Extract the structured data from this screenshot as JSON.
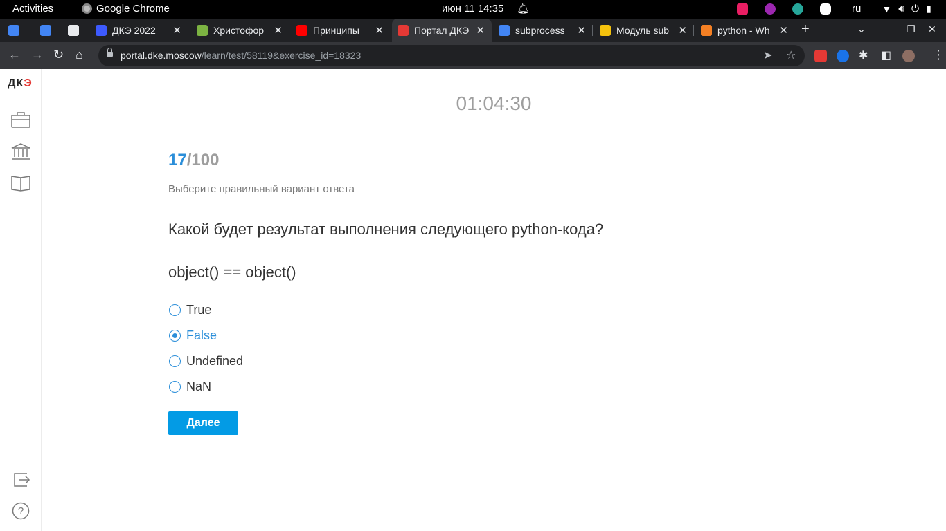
{
  "system": {
    "activities": "Activities",
    "app_name": "Google Chrome",
    "clock": "июн 11  14:35",
    "language": "ru"
  },
  "tabs": [
    {
      "title": "",
      "favicon_color": "#4285f4"
    },
    {
      "title": "",
      "favicon_color": "#4285f4"
    },
    {
      "title": "",
      "favicon_color": "#e8eaed"
    },
    {
      "title": "ДКЭ 2022",
      "favicon_color": "#3d5afe"
    },
    {
      "title": "Христофор",
      "favicon_color": "#7cb342"
    },
    {
      "title": "Принципы",
      "favicon_color": "#ff0000"
    },
    {
      "title": "Портал ДКЭ",
      "favicon_color": "#e53935"
    },
    {
      "title": "subprocess",
      "favicon_color": "#4285f4"
    },
    {
      "title": "Модуль sub",
      "favicon_color": "#f4c20d"
    },
    {
      "title": "python - Wh",
      "favicon_color": "#f48024"
    }
  ],
  "browser": {
    "url_host": "portal.dke.moscow",
    "url_path": "/learn/test/58119&exercise_id=18323"
  },
  "sidebar": {
    "logo_main": "ДК",
    "logo_accent": "Э"
  },
  "quiz": {
    "timer": "01:04:30",
    "current": "17",
    "total": "/100",
    "hint": "Выберите правильный вариант ответа",
    "question": "Какой будет результат выполнения следующего python-кода?",
    "code": "object() == object()",
    "options": [
      {
        "label": "True",
        "selected": false
      },
      {
        "label": "False",
        "selected": true
      },
      {
        "label": "Undefined",
        "selected": false
      },
      {
        "label": "NaN",
        "selected": false
      }
    ],
    "next_label": "Далее"
  }
}
